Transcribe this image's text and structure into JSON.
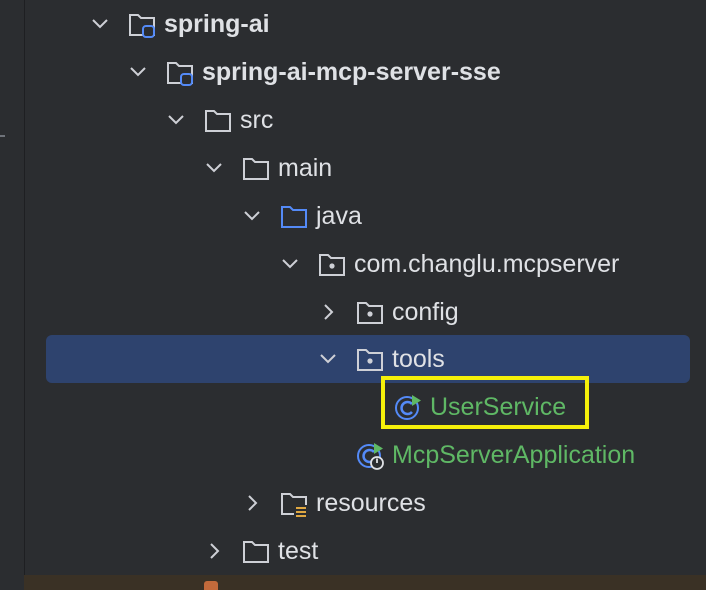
{
  "tree": {
    "items": [
      {
        "label": "spring-ai",
        "icon": "module-folder-icon",
        "expanded": true
      },
      {
        "label": "spring-ai-mcp-server-sse",
        "icon": "module-folder-icon",
        "expanded": true
      },
      {
        "label": "src",
        "icon": "folder-icon",
        "expanded": true
      },
      {
        "label": "main",
        "icon": "folder-icon",
        "expanded": true
      },
      {
        "label": "java",
        "icon": "source-folder-icon",
        "expanded": true
      },
      {
        "label": "com.changlu.mcpserver",
        "icon": "package-icon",
        "expanded": true
      },
      {
        "label": "config",
        "icon": "package-icon",
        "expanded": false
      },
      {
        "label": "tools",
        "icon": "package-icon",
        "expanded": true,
        "selected": true
      },
      {
        "label": "UserService",
        "icon": "spring-class-icon",
        "highlighted": true
      },
      {
        "label": "McpServerApplication",
        "icon": "spring-boot-app-icon"
      },
      {
        "label": "resources",
        "icon": "resources-folder-icon",
        "expanded": false
      },
      {
        "label": "test",
        "icon": "folder-icon",
        "expanded": false
      }
    ]
  },
  "colors": {
    "background": "#2b2d30",
    "selection": "#2e436e",
    "highlight_border": "#f5f00a",
    "class_text": "#5fb865",
    "folder_blue": "#548af7"
  }
}
